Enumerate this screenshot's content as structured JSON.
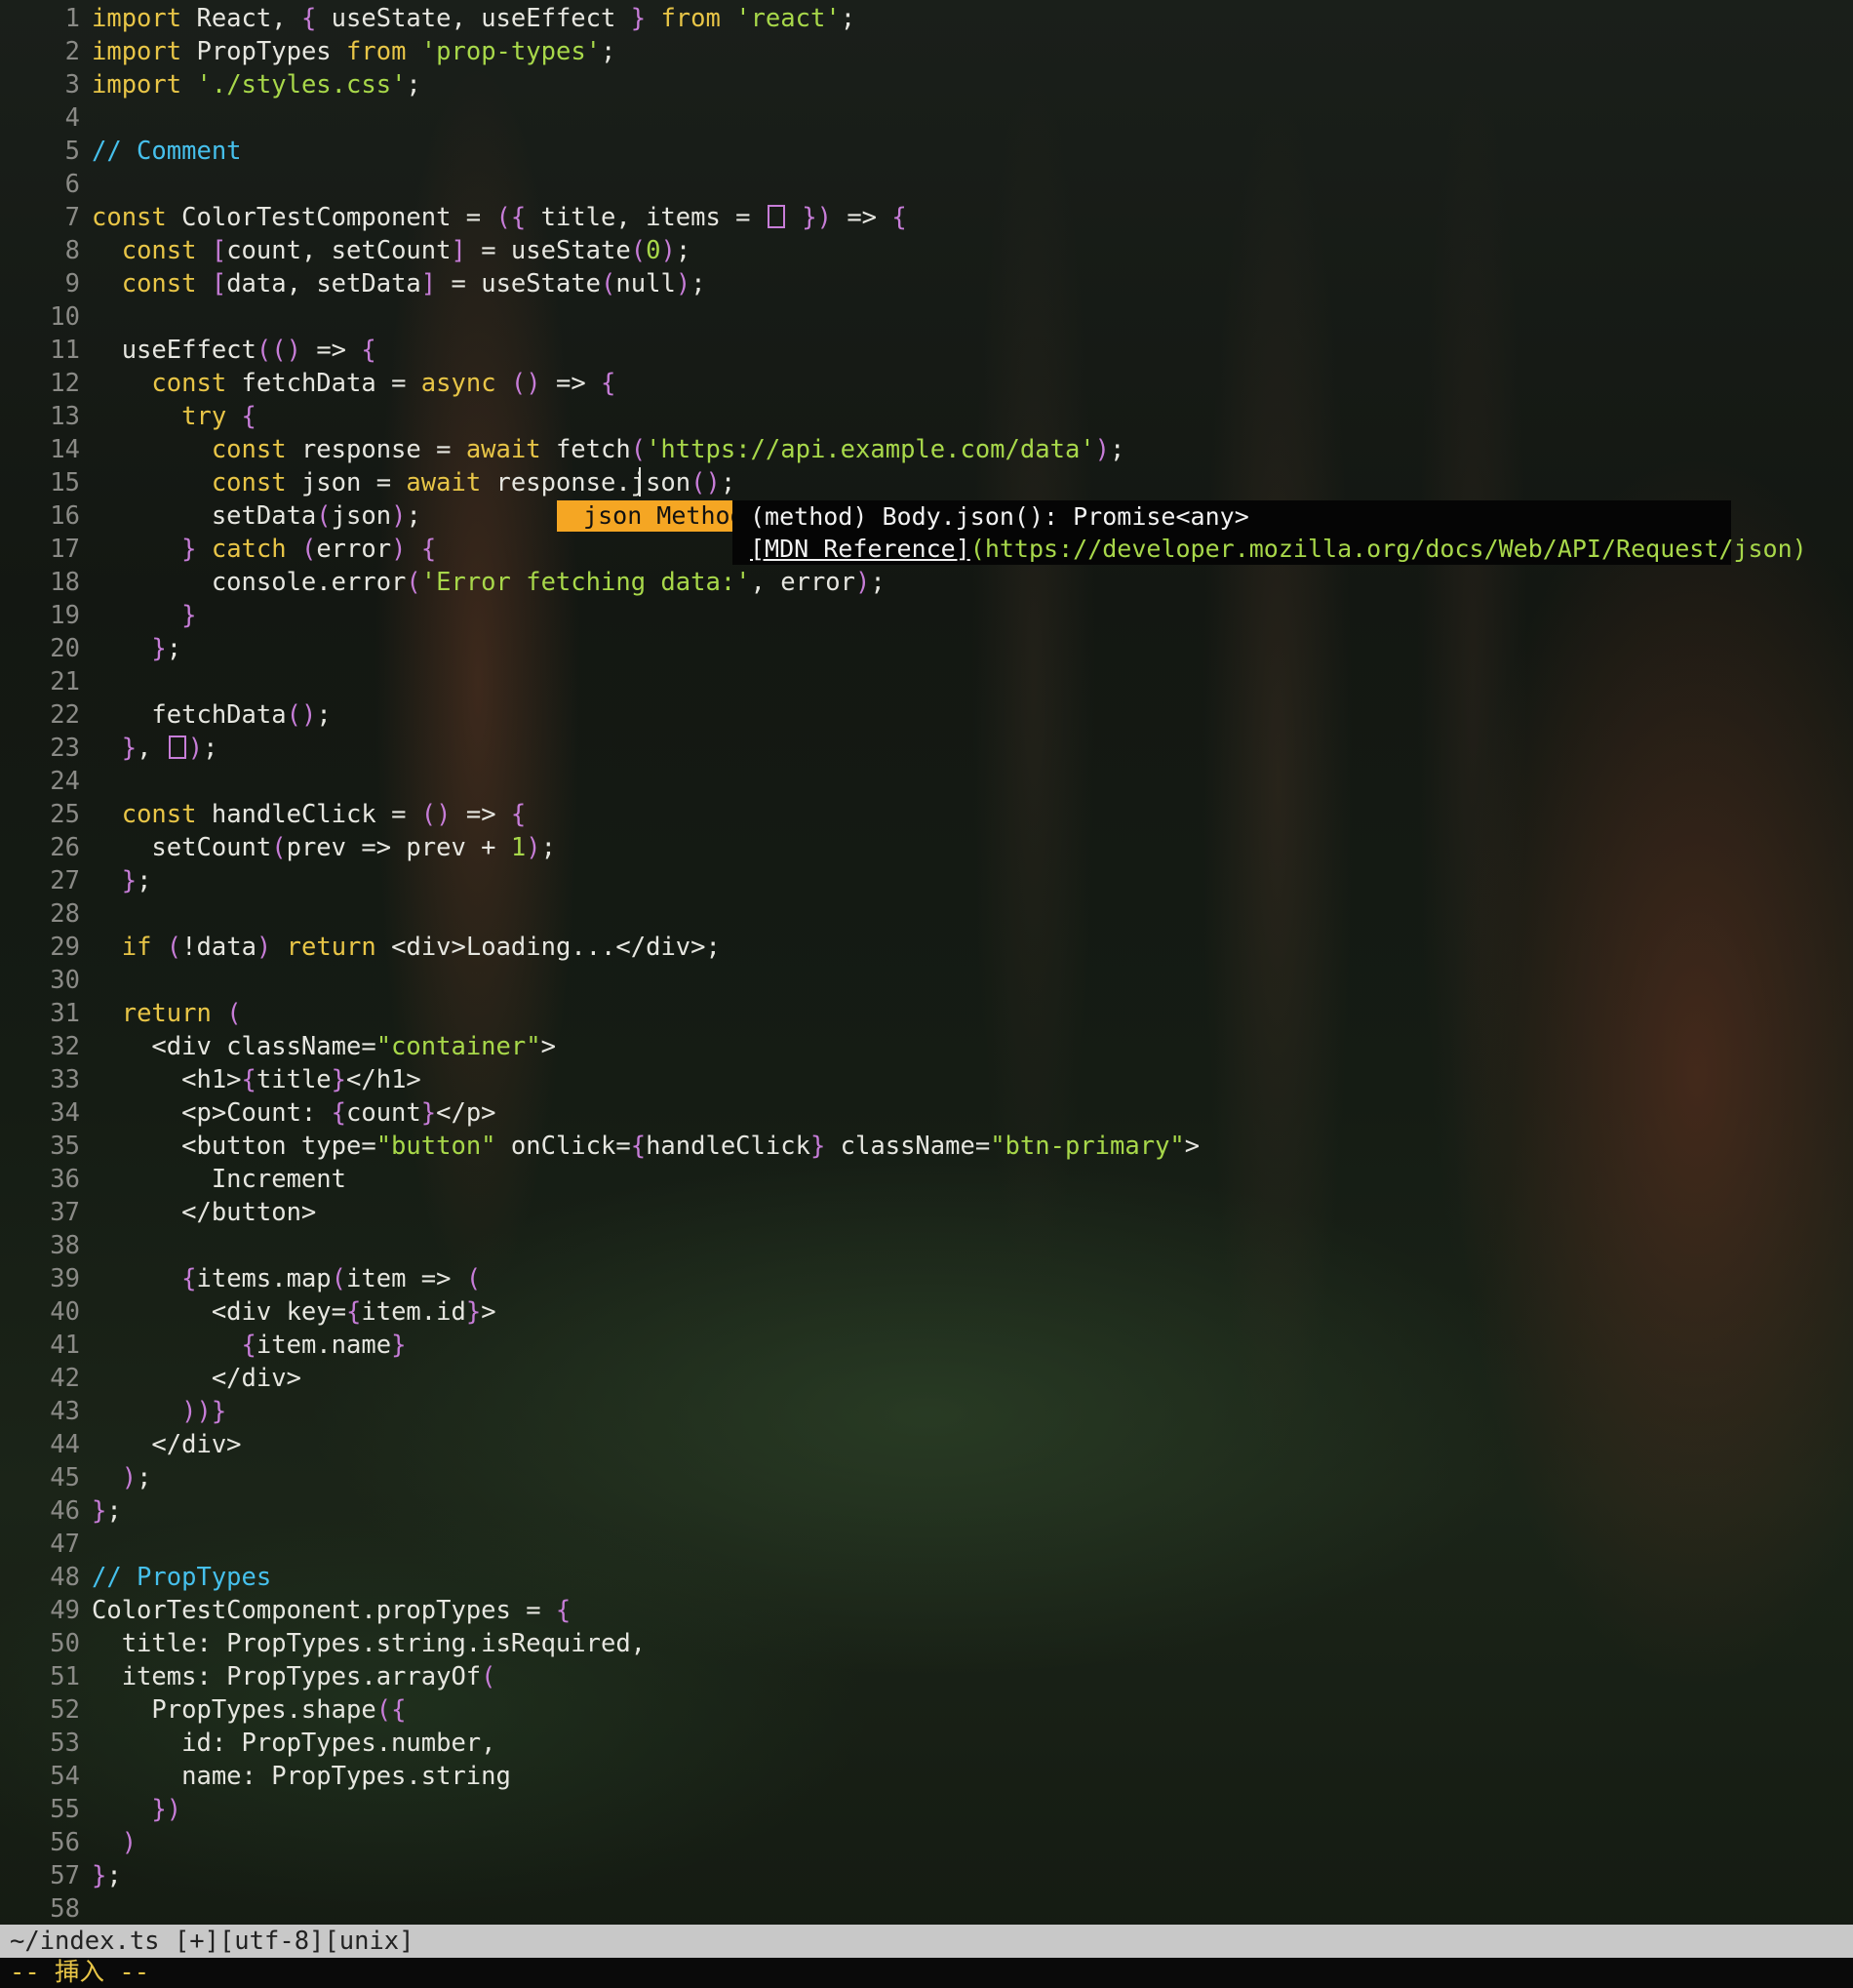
{
  "editor": {
    "gutter_color": "#8a8a86",
    "text_color": "#e6e6e0",
    "keyword_color": "#e8c547",
    "string_color": "#a8d84a",
    "comment_color": "#46c0ec",
    "bracket_color": "#c77dd8",
    "lines": [
      "import React, { useState, useEffect } from 'react';",
      "import PropTypes from 'prop-types';",
      "import './styles.css';",
      "",
      "// Comment",
      "",
      "const ColorTestComponent = ({ title, items = [] }) => {",
      "  const [count, setCount] = useState(0);",
      "  const [data, setData] = useState(null);",
      "",
      "  useEffect(() => {",
      "    const fetchData = async () => {",
      "      try {",
      "        const response = await fetch('https://api.example.com/data');",
      "        const json = await response.json();",
      "        setData(json);",
      "      } catch (error) {",
      "        console.error('Error fetching data:', error);",
      "      }",
      "    };",
      "",
      "    fetchData();",
      "  }, []);",
      "",
      "  const handleClick = () => {",
      "    setCount(prev => prev + 1);",
      "  };",
      "",
      "  if (!data) return <div>Loading...</div>;",
      "",
      "  return (",
      "    <div className=\"container\">",
      "      <h1>{title}</h1>",
      "      <p>Count: {count}</p>",
      "      <button type=\"button\" onClick={handleClick} className=\"btn-primary\">",
      "        Increment",
      "      </button>",
      "",
      "      {items.map(item => (",
      "        <div key={item.id}>",
      "          {item.name}",
      "        </div>",
      "      ))}",
      "    </div>",
      "  );",
      "};",
      "",
      "// PropTypes",
      "ColorTestComponent.propTypes = {",
      "  title: PropTypes.string.isRequired,",
      "  items: PropTypes.arrayOf(",
      "    PropTypes.shape({",
      "      id: PropTypes.number,",
      "      name: PropTypes.string",
      "    })",
      "  )",
      "};",
      ""
    ]
  },
  "completion": {
    "selected_item": " json Method ",
    "item_color": "#f5a623",
    "signature": "(method) Body.json(): Promise<any>",
    "reference_label": "[MDN Reference]",
    "reference_url": "(https://developer.mozilla.org/docs/Web/API/Request/json)"
  },
  "statusline": {
    "text": "~/index.ts [+][utf-8][unix]"
  },
  "modeline": {
    "text": "-- 挿入 --"
  }
}
